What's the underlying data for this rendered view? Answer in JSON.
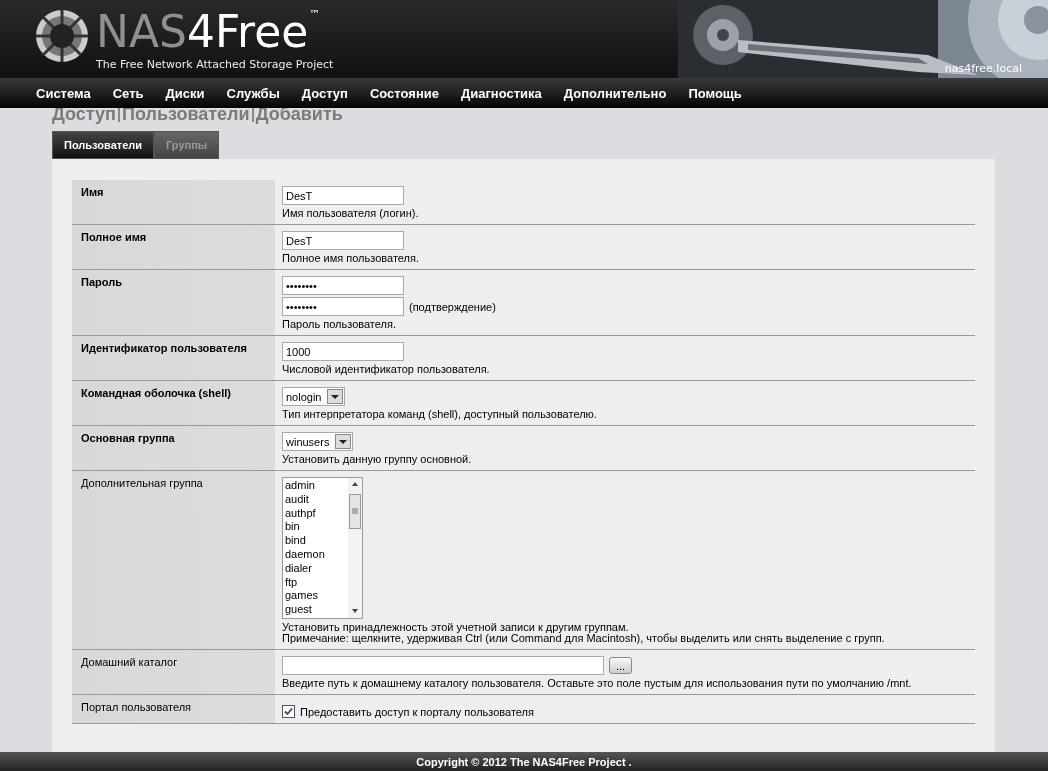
{
  "header": {
    "logo_prefix": "NAS",
    "logo_suffix": "4Free",
    "trademark": "™",
    "tagline": "The Free Network Attached Storage Project",
    "hostname": "nas4free.local"
  },
  "nav": [
    "Система",
    "Сеть",
    "Диски",
    "Службы",
    "Доступ",
    "Состояние",
    "Диагностика",
    "Дополнительно",
    "Помощь"
  ],
  "breadcrumb": [
    "Доступ",
    "Пользователи",
    "Добавить"
  ],
  "tabs": [
    {
      "label": "Пользователи",
      "selected": true
    },
    {
      "label": "Группы",
      "selected": false
    }
  ],
  "rows": [
    {
      "kind": "text",
      "label": "Имя",
      "bold": true,
      "value": "DesT",
      "hint": "Имя пользователя (логин)."
    },
    {
      "kind": "text",
      "label": "Полное имя",
      "bold": true,
      "value": "DesT",
      "hint": "Полное имя пользователя."
    },
    {
      "kind": "password",
      "label": "Пароль",
      "bold": true,
      "value": "••••••••",
      "confirm_value": "••••••••",
      "confirm_label": "(подтверждение)",
      "hint": "Пароль пользователя."
    },
    {
      "kind": "text",
      "label": "Идентификатор пользователя",
      "bold": true,
      "value": "1000",
      "hint": "Числовой идентификатор пользователя."
    },
    {
      "kind": "select",
      "label": "Командная оболочка (shell)",
      "bold": true,
      "value": "nologin",
      "hint": "Тип интерпретатора команд (shell), доступный пользователю."
    },
    {
      "kind": "select",
      "label": "Основная группа",
      "bold": true,
      "value": "winusers",
      "hint": "Установить данную группу основной."
    },
    {
      "kind": "listbox",
      "label": "Дополнительная группа",
      "bold": false,
      "options": [
        "admin",
        "audit",
        "authpf",
        "bin",
        "bind",
        "daemon",
        "dialer",
        "ftp",
        "games",
        "guest"
      ],
      "hint": "Установить принадлежность этой учетной записи к другим группам.",
      "note": "Примечание: щелкните, удерживая Ctrl (или Command для Macintosh), чтобы выделить или снять выделение с групп."
    },
    {
      "kind": "path",
      "label": "Домашний каталог",
      "bold": false,
      "button": "...",
      "hint": "Введите путь к домашнему каталогу пользователя. Оставьте это поле пустым для использования пути по умолчанию /mnt."
    },
    {
      "kind": "checkbox",
      "label": "Портал пользователя",
      "bold": false,
      "checked": true,
      "caption": "Предоставить доступ к порталу пользователя"
    }
  ],
  "footer": "Copyright © 2012 The NAS4Free Project ."
}
